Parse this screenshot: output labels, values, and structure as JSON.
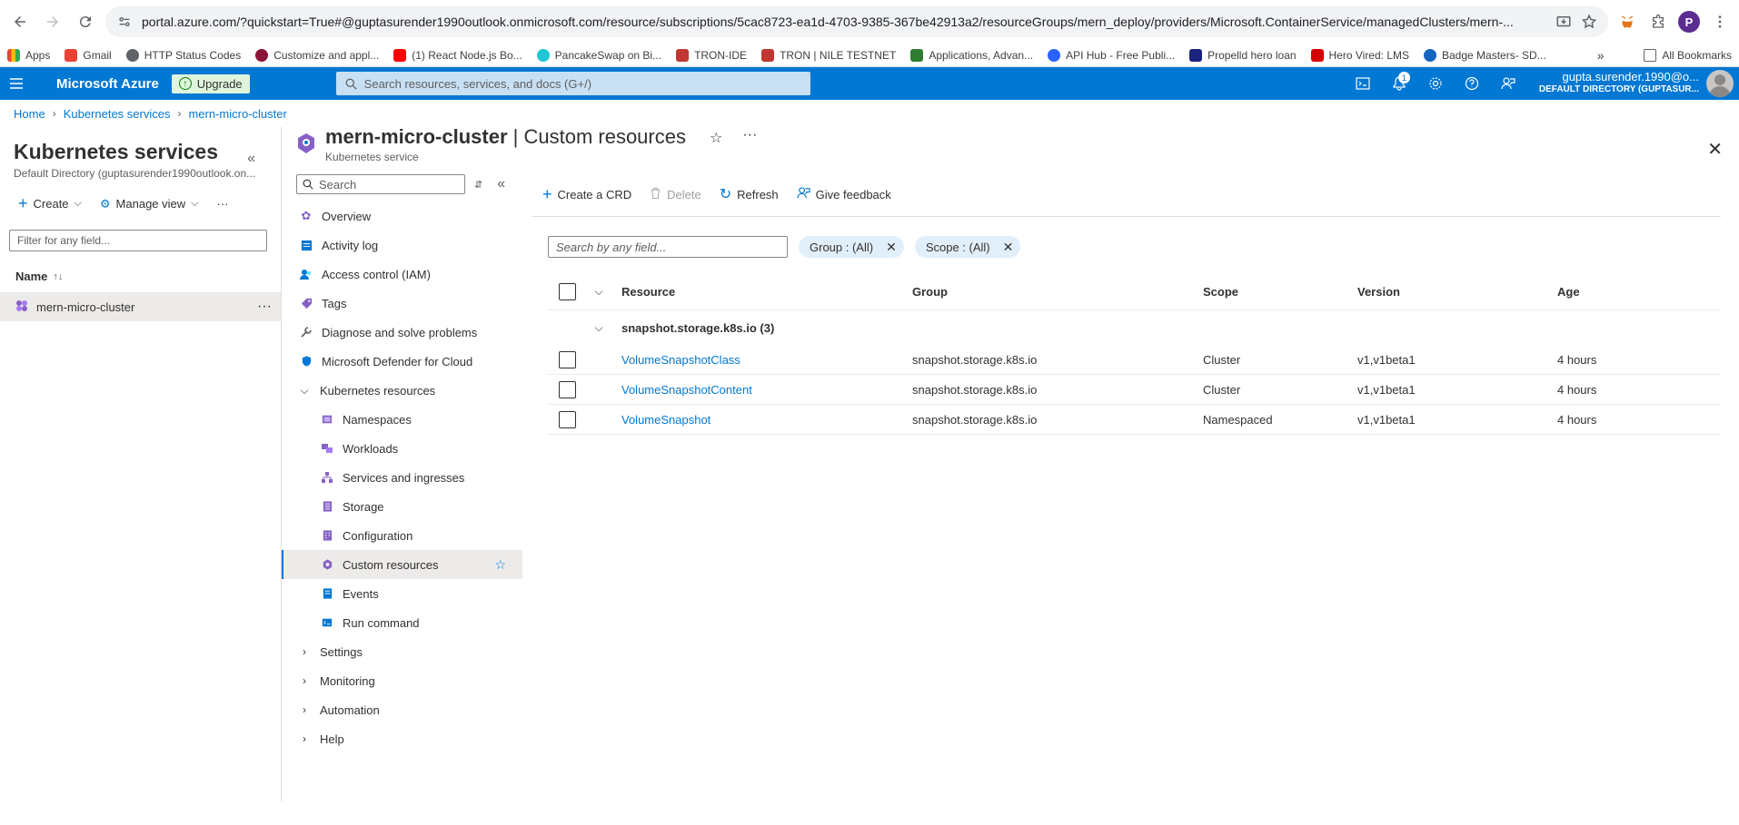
{
  "browser": {
    "url": "portal.azure.com/?quickstart=True#@guptasurender1990outlook.onmicrosoft.com/resource/subscriptions/5cac8723-ea1d-4703-9385-367be42913a2/resourceGroups/mern_deploy/providers/Microsoft.ContainerService/managedClusters/mern-...",
    "profile_initial": "P",
    "bookmarks": [
      {
        "label": "Apps",
        "color": "#4285f4"
      },
      {
        "label": "Gmail",
        "color": "#ea4335"
      },
      {
        "label": "HTTP Status Codes",
        "color": "#5f6368"
      },
      {
        "label": "Customize and appl...",
        "color": "#8a1538"
      },
      {
        "label": "(1) React Node.js Bo...",
        "color": "#ff0000"
      },
      {
        "label": "PancakeSwap on Bi...",
        "color": "#1fc7d4"
      },
      {
        "label": "TRON-IDE",
        "color": "#c23631"
      },
      {
        "label": "TRON | NILE TESTNET",
        "color": "#c23631"
      },
      {
        "label": "Applications, Advan...",
        "color": "#2e7d32"
      },
      {
        "label": "API Hub - Free Publi...",
        "color": "#2962ff"
      },
      {
        "label": "Propelld hero loan",
        "color": "#1a237e"
      },
      {
        "label": "Hero Vired: LMS",
        "color": "#d50000"
      },
      {
        "label": "Badge Masters- SD...",
        "color": "#1565c0"
      }
    ],
    "all_bookmarks": "All Bookmarks"
  },
  "azure": {
    "brand": "Microsoft Azure",
    "upgrade": "Upgrade",
    "search_placeholder": "Search resources, services, and docs (G+/)",
    "notification_count": "1",
    "account_name": "gupta.surender.1990@o...",
    "account_dir": "DEFAULT DIRECTORY (GUPTASUR..."
  },
  "breadcrumb": [
    "Home",
    "Kubernetes services",
    "mern-micro-cluster"
  ],
  "services": {
    "title": "Kubernetes services",
    "subtitle": "Default Directory (guptasurender1990outlook.on...",
    "create": "Create",
    "manage_view": "Manage view",
    "filter_placeholder": "Filter for any field...",
    "name_header": "Name",
    "items": [
      "mern-micro-cluster"
    ]
  },
  "page": {
    "title": "mern-micro-cluster",
    "section": "Custom resources",
    "subtitle": "Kubernetes service"
  },
  "menu": {
    "search_placeholder": "Search",
    "items": [
      {
        "label": "Overview",
        "icon": "overview-icon",
        "level": 0
      },
      {
        "label": "Activity log",
        "icon": "activity-log-icon",
        "level": 0
      },
      {
        "label": "Access control (IAM)",
        "icon": "iam-icon",
        "level": 0
      },
      {
        "label": "Tags",
        "icon": "tag-icon",
        "level": 0
      },
      {
        "label": "Diagnose and solve problems",
        "icon": "wrench-icon",
        "level": 0
      },
      {
        "label": "Microsoft Defender for Cloud",
        "icon": "shield-icon",
        "level": 0
      },
      {
        "label": "Kubernetes resources",
        "icon": "chevron-down-icon",
        "level": 0
      },
      {
        "label": "Namespaces",
        "icon": "namespace-icon",
        "level": 1
      },
      {
        "label": "Workloads",
        "icon": "workloads-icon",
        "level": 1
      },
      {
        "label": "Services and ingresses",
        "icon": "network-icon",
        "level": 1
      },
      {
        "label": "Storage",
        "icon": "storage-icon",
        "level": 1
      },
      {
        "label": "Configuration",
        "icon": "config-icon",
        "level": 1
      },
      {
        "label": "Custom resources",
        "icon": "custom-resources-icon",
        "level": 1
      },
      {
        "label": "Events",
        "icon": "events-icon",
        "level": 1
      },
      {
        "label": "Run command",
        "icon": "terminal-icon",
        "level": 1
      },
      {
        "label": "Settings",
        "icon": "chevron-right-icon",
        "level": 0
      },
      {
        "label": "Monitoring",
        "icon": "chevron-right-icon",
        "level": 0
      },
      {
        "label": "Automation",
        "icon": "chevron-right-icon",
        "level": 0
      },
      {
        "label": "Help",
        "icon": "chevron-right-icon",
        "level": 0
      }
    ]
  },
  "toolbar": {
    "create_crd": "Create a CRD",
    "delete": "Delete",
    "refresh": "Refresh",
    "feedback": "Give feedback"
  },
  "filters": {
    "search_placeholder": "Search by any field...",
    "group_pill": "Group : (All)",
    "scope_pill": "Scope : (All)"
  },
  "table": {
    "headers": {
      "resource": "Resource",
      "group": "Group",
      "scope": "Scope",
      "version": "Version",
      "age": "Age"
    },
    "group_label": "snapshot.storage.k8s.io (3)",
    "rows": [
      {
        "resource": "VolumeSnapshotClass",
        "group": "snapshot.storage.k8s.io",
        "scope": "Cluster",
        "version": "v1,v1beta1",
        "age": "4 hours"
      },
      {
        "resource": "VolumeSnapshotContent",
        "group": "snapshot.storage.k8s.io",
        "scope": "Cluster",
        "version": "v1,v1beta1",
        "age": "4 hours"
      },
      {
        "resource": "VolumeSnapshot",
        "group": "snapshot.storage.k8s.io",
        "scope": "Namespaced",
        "version": "v1,v1beta1",
        "age": "4 hours"
      }
    ]
  }
}
